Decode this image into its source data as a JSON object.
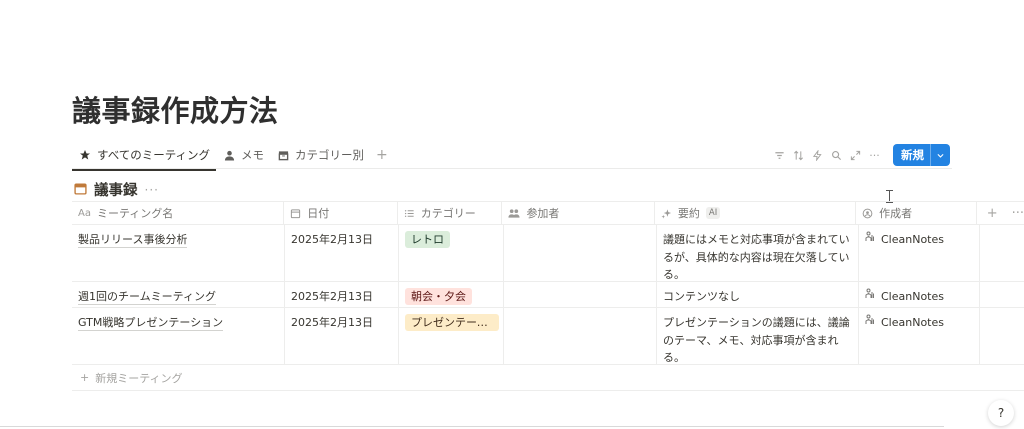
{
  "page": {
    "title": "議事録作成方法"
  },
  "views": {
    "tabs": [
      {
        "label": "すべてのミーティング",
        "icon": "star-icon",
        "active": true
      },
      {
        "label": "メモ",
        "icon": "person-icon",
        "active": false
      },
      {
        "label": "カテゴリー別",
        "icon": "board-icon",
        "active": false
      }
    ],
    "add": "+"
  },
  "toolbar": {
    "more": "···",
    "new_label": "新規",
    "new_arrow": "⌄",
    "accent": "#2383e2"
  },
  "database": {
    "title": "議事録",
    "more": "···"
  },
  "table": {
    "columns": [
      {
        "label": "ミーティング名",
        "icon": "Aa"
      },
      {
        "label": "日付",
        "icon": "calendar-icon"
      },
      {
        "label": "カテゴリー",
        "icon": "list-icon"
      },
      {
        "label": "参加者",
        "icon": "people-icon"
      },
      {
        "label": "要約",
        "icon": "sparkle-icon",
        "badge": "AI"
      },
      {
        "label": "作成者",
        "icon": "user-circle-icon"
      }
    ],
    "header_add": "+",
    "header_more": "···",
    "rows": [
      {
        "name": "製品リリース事後分析",
        "date": "2025年2月13日",
        "category": {
          "label": "レトロ",
          "bg": "#dbeddb",
          "color": "#1c3829"
        },
        "participants": "",
        "summary": "議題にはメモと対応事項が含まれているが、具体的な内容は現在欠落している。",
        "creator": "CleanNotes"
      },
      {
        "name": "週1回のチームミーティング",
        "date": "2025年2月13日",
        "category": {
          "label": "朝会・夕会",
          "bg": "#ffe2dd",
          "color": "#5d1715"
        },
        "participants": "",
        "summary": "コンテンツなし",
        "creator": "CleanNotes"
      },
      {
        "name": "GTM戦略プレゼンテーション",
        "date": "2025年2月13日",
        "category": {
          "label": "プレゼンテーシ...",
          "bg": "#fdecc8",
          "color": "#402c1b"
        },
        "participants": "",
        "summary": "プレゼンテーションの議題には、議論のテーマ、メモ、対応事項が含まれる。",
        "creator": "CleanNotes"
      }
    ],
    "new_row_label": "新規ミーティング"
  },
  "help": {
    "label": "?"
  }
}
